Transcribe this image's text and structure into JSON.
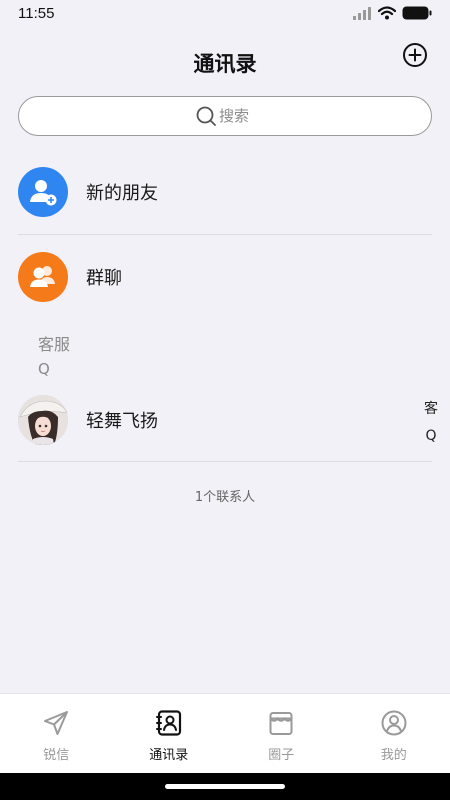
{
  "status": {
    "time": "11:55"
  },
  "header": {
    "title": "通讯录"
  },
  "search": {
    "placeholder": "搜索"
  },
  "top_items": [
    {
      "label": "新的朋友",
      "color": "#2f86f0",
      "icon": "user-plus-icon"
    },
    {
      "label": "群聊",
      "color": "#f57a1a",
      "icon": "group-icon"
    }
  ],
  "section": {
    "title": "客服",
    "letter": "Q"
  },
  "contacts": [
    {
      "name": "轻舞飞扬",
      "avatar": "avatar-photo"
    }
  ],
  "index_bar": [
    "客",
    "Q"
  ],
  "footer": {
    "contact_count": "1个联系人"
  },
  "tabs": [
    {
      "label": "锐信",
      "icon": "send-icon",
      "active": false
    },
    {
      "label": "通讯录",
      "icon": "contacts-book-icon",
      "active": true
    },
    {
      "label": "圈子",
      "icon": "shop-icon",
      "active": false
    },
    {
      "label": "我的",
      "icon": "profile-icon",
      "active": false
    }
  ]
}
